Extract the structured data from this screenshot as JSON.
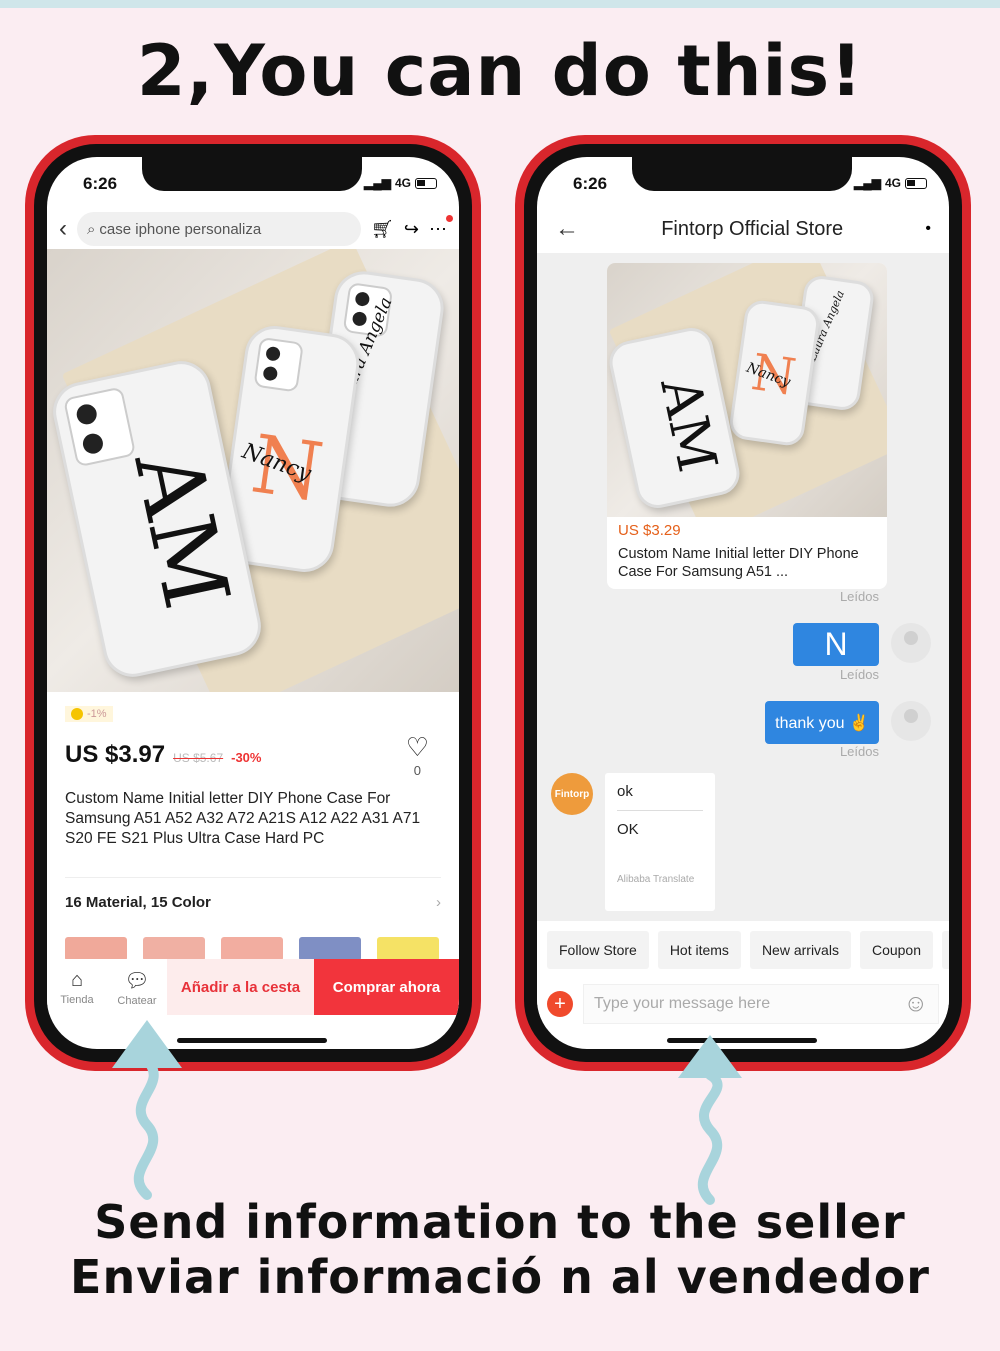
{
  "headline": "2,You can do this!",
  "status": {
    "time": "6:26",
    "network": "4G"
  },
  "product_page": {
    "search_placeholder": "case iphone personaliza",
    "coin_badge": "-1%",
    "price": "US $3.97",
    "old_price": "US $5.67",
    "discount": "-30%",
    "wishlist_count": "0",
    "title": "Custom Name Initial letter DIY Phone Case For Samsung A51 A52 A32 A72 A21S A12 A22 A31 A71 S20 FE S21 Plus Ultra Case Hard PC",
    "variants": "16 Material, 15 Color",
    "swatch_colors": [
      "#f0a99a",
      "#f0b0a3",
      "#f2ada0",
      "#7f8fc4",
      "#f5e265"
    ],
    "photo_lettering": [
      "AM",
      "Nancy",
      "Laura Angela"
    ],
    "tabs": [
      {
        "label": "Tienda",
        "icon": "store-icon"
      },
      {
        "label": "Chatear",
        "icon": "chat-icon"
      }
    ],
    "add_to_cart": "Añadir a la cesta",
    "buy_now": "Comprar ahora"
  },
  "chat_page": {
    "store_name": "Fintorp Official Store",
    "product_card": {
      "price": "US $3.29",
      "title": "Custom Name Initial letter DIY Phone Case For Samsung A51 ..."
    },
    "read_label": "Leídos",
    "messages": [
      {
        "text": "N"
      },
      {
        "text": "thank you ✌"
      }
    ],
    "seller_avatar": "Fintorp",
    "seller_reply": {
      "original": "ok",
      "translated": "OK",
      "translator": "Alibaba Translate"
    },
    "quick_replies": [
      "Follow Store",
      "Hot items",
      "New arrivals",
      "Coupon",
      "S"
    ],
    "input_placeholder": "Type your message here"
  },
  "captions": [
    "Send information to the seller",
    "Enviar informació n al vendedor"
  ],
  "colors": {
    "frame": "#d9262c",
    "accent_red": "#f2343c",
    "bubble_blue": "#2f86e0",
    "arrow": "#a8d4dc",
    "background": "#fbedf2"
  }
}
